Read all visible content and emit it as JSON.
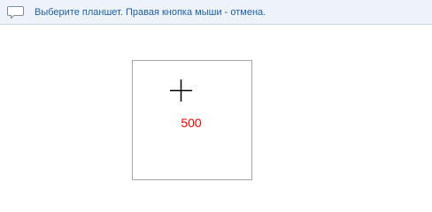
{
  "prompt": {
    "icon": "speech-bubble-icon",
    "text": "Выберите планшет. Правая кнопка мыши - отмена."
  },
  "viewport": {
    "cursor_icon": "crosshair-icon",
    "scale_label": "500",
    "scale_label_color": "#ff0000"
  }
}
